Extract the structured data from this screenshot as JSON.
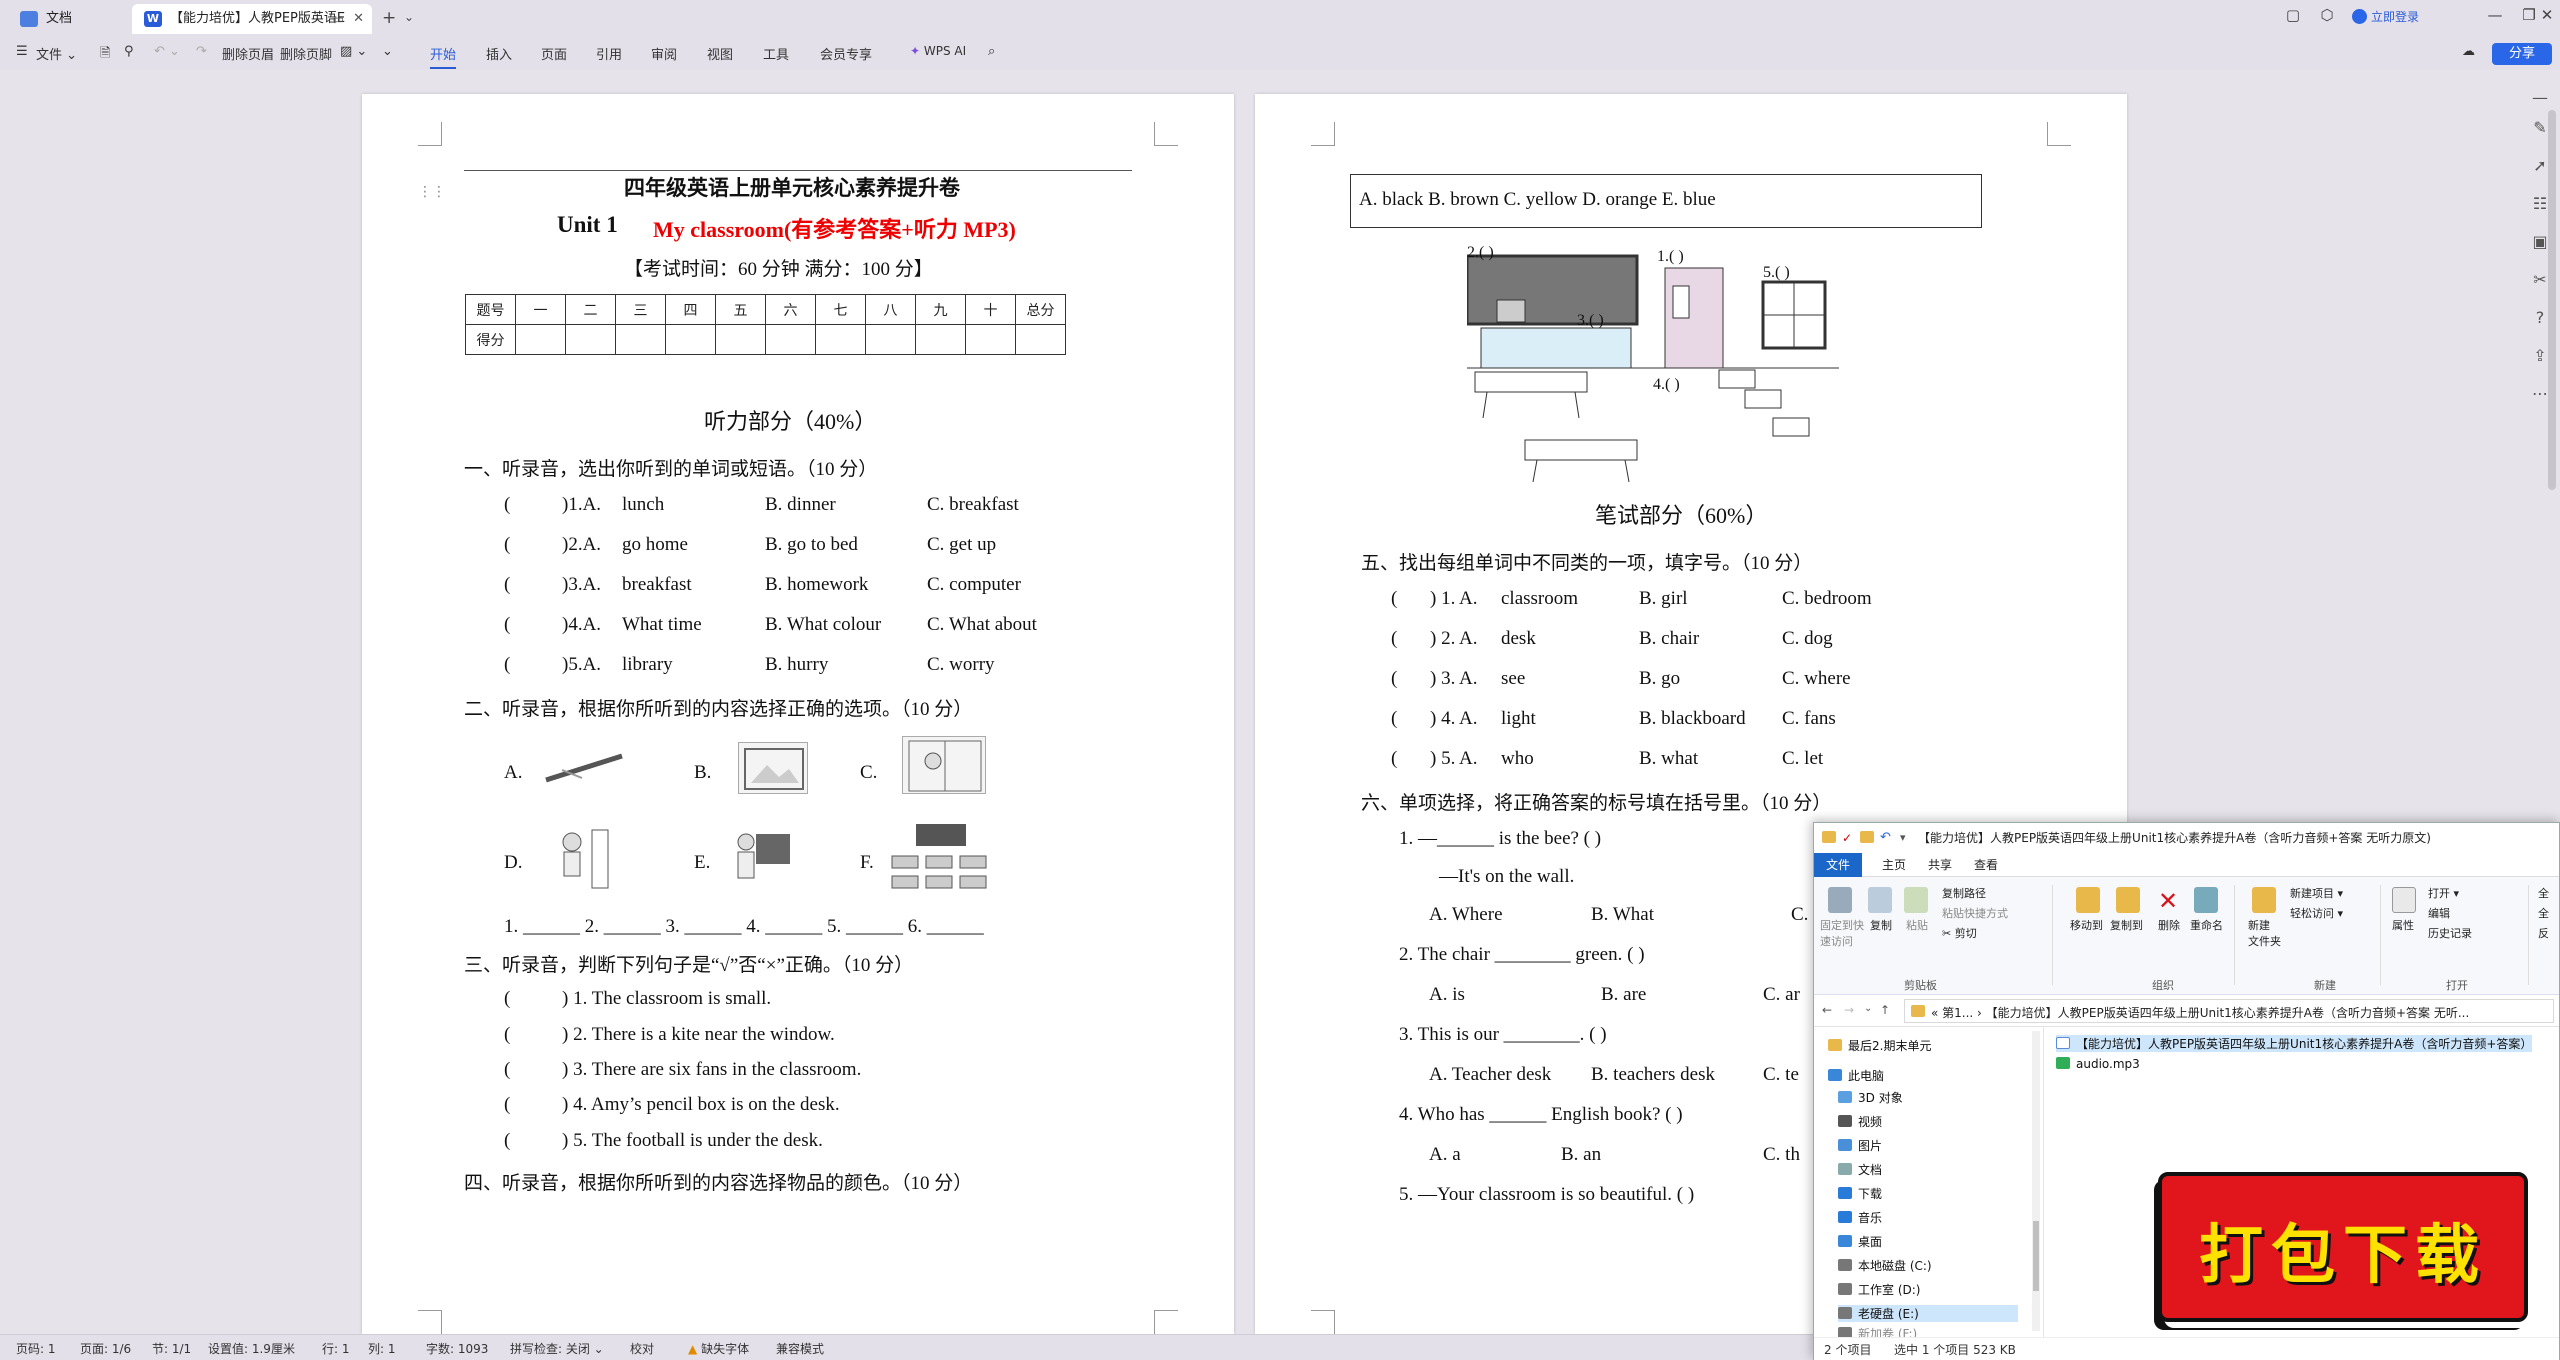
{
  "tabs": {
    "home": "文档",
    "doc": "【能力培优】人教PEP版英语E"
  },
  "titlebar": {
    "login": "立即登录"
  },
  "toolbar": {
    "file": "文件",
    "delete_header": "删除页眉",
    "delete_footer": "删除页脚",
    "menus": [
      "开始",
      "插入",
      "页面",
      "引用",
      "审阅",
      "视图",
      "工具",
      "会员专享"
    ],
    "wps_ai": "WPS AI",
    "share": "分享"
  },
  "page1": {
    "title": "四年级英语上册单元核心素养提升卷",
    "unit": "Unit 1",
    "unit_title": "My classroom(有参考答案+听力 MP3)",
    "exam_info": "【考试时间：60 分钟 满分：100 分】",
    "score_header": [
      "题号",
      "一",
      "二",
      "三",
      "四",
      "五",
      "六",
      "七",
      "八",
      "九",
      "十",
      "总分"
    ],
    "score_row_label": "得分",
    "listening_heading": "听力部分（40%）",
    "s1_title": "一、听录音，选出你听到的单词或短语。（10 分）",
    "s1_items": [
      {
        "num": ")1.A.",
        "a": "lunch",
        "b": "B.   dinner",
        "c": "C.   breakfast"
      },
      {
        "num": ")2.A.",
        "a": "go home",
        "b": "B.   go to bed",
        "c": "C.   get up"
      },
      {
        "num": ")3.A.",
        "a": "breakfast",
        "b": "B.   homework",
        "c": "C.   computer"
      },
      {
        "num": ")4.A.",
        "a": "What time",
        "b": "B.   What colour",
        "c": "C.   What about"
      },
      {
        "num": ")5.A.",
        "a": "library",
        "b": "B.   hurry",
        "c": "C.   worry"
      }
    ],
    "s2_title": "二、听录音，根据你所听到的内容选择正确的选项。（10 分）",
    "s2_labels": [
      "A.",
      "B.",
      "C.",
      "D.",
      "E.",
      "F."
    ],
    "s2_blanks": "1. ______   2. ______   3. ______   4. ______   5. ______   6. ______",
    "s3_title": "三、听录音，判断下列句子是“√”否“×”正确。（10 分）",
    "s3_items": [
      ") 1. The classroom is small.",
      ") 2. There is a kite near the window.",
      ") 3. There are six fans in the classroom.",
      ") 4. Amy’s pencil box is on the desk.",
      ") 5. The football is under the desk."
    ],
    "s4_title": "四、听录音，根据你所听到的内容选择物品的颜色。（10 分）"
  },
  "page2": {
    "colors_box": "A.  black      B.  brown      C.  yellow      D.  orange      E.  blue",
    "pic_labels": [
      "2.(      )",
      "1.(      )",
      "5.(      )",
      "3.(      )",
      "4.(      )"
    ],
    "writing_heading": "笔试部分（60%）",
    "s5_title": "五、找出每组单词中不同类的一项，填字号。（10 分）",
    "s5_items": [
      {
        "num": ")  1.  A.",
        "a": "classroom",
        "b": "B.   girl",
        "c": "C.   bedroom"
      },
      {
        "num": ")  2.  A.",
        "a": "desk",
        "b": "B.   chair",
        "c": "C.   dog"
      },
      {
        "num": ")  3.  A.",
        "a": "see",
        "b": "B.   go",
        "c": "C.   where"
      },
      {
        "num": ")  4.  A.",
        "a": "light",
        "b": "B.   blackboard",
        "c": "C.   fans"
      },
      {
        "num": ")  5.  A.",
        "a": "who",
        "b": "B.   what",
        "c": "C.   let"
      }
    ],
    "s6_title": "六、单项选择，将正确答案的标号填在括号里。（10 分）",
    "s6_q1": "1.     —______ is the bee? (     )",
    "s6_q1b": "—It's on the wall.",
    "s6_q1_opts": [
      "A.   Where",
      "B.   What",
      "C."
    ],
    "s6_q2": "2.     The chair ________ green. (     )",
    "s6_q2_opts": [
      "A.   is",
      "B.   are",
      "C.   ar"
    ],
    "s6_q3": "3.     This is our ________. (      )",
    "s6_q3_opts": [
      "A.   Teacher desk",
      "B.   teachers desk",
      "C.   te"
    ],
    "s6_q4": "4.     Who has ______ English book? (     )",
    "s6_q4_opts": [
      "A.   a",
      "B.   an",
      "C.   th"
    ],
    "s6_q5": "5.     —Your classroom is so beautiful. (     )"
  },
  "statusbar": {
    "page": "页码: 1",
    "pages": "页面: 1/6",
    "section": "节: 1/1",
    "setting": "设置值: 1.9厘米",
    "row": "行: 1",
    "col": "列: 1",
    "words": "字数: 1093",
    "spell": "拼写检查: 关闭 ⌄",
    "proof": "校对",
    "missing_font": "缺失字体",
    "compat": "兼容模式"
  },
  "explorer": {
    "title": "【能力培优】人教PEP版英语四年级上册Unit1核心素养提升A卷（含听力音频+答案 无听力原文)",
    "tabs": [
      "文件",
      "主页",
      "共享",
      "查看"
    ],
    "ribbon": {
      "pin": "固定到快\n速访问",
      "copy": "复制",
      "paste": "粘贴",
      "copy_path": "复制路径",
      "paste_shortcut": "粘贴快捷方式",
      "cut": "剪切",
      "group_clipboard": "剪贴板",
      "move_to": "移动到",
      "copy_to": "复制到",
      "delete": "删除",
      "rename": "重命名",
      "group_organize": "组织",
      "new_folder": "新建\n文件夹",
      "new_item": "新建项目 ▾",
      "easy_access": "轻松访问 ▾",
      "group_new": "新建",
      "properties": "属性",
      "open": "打开 ▾",
      "edit": "编辑",
      "history": "历史记录",
      "group_open": "打开",
      "select_all": "全",
      "select_none": "全",
      "invert": "反"
    },
    "address": "«  第1...  ›  【能力培优】人教PEP版英语四年级上册Unit1核心素养提升A卷（含听力音频+答案 无听...",
    "nav": [
      {
        "label": "最后2.期末单元",
        "color": "#e8b84a",
        "top": true
      },
      {
        "label": "此电脑",
        "color": "#3a86d9",
        "top": true
      },
      {
        "label": "3D 对象",
        "color": "#5aa0e0"
      },
      {
        "label": "视频",
        "color": "#555"
      },
      {
        "label": "图片",
        "color": "#4a90d9"
      },
      {
        "label": "文档",
        "color": "#8aa"
      },
      {
        "label": "下载",
        "color": "#2a7ad9"
      },
      {
        "label": "音乐",
        "color": "#2a7ad9"
      },
      {
        "label": "桌面",
        "color": "#3a86d9"
      },
      {
        "label": "本地磁盘 (C:)",
        "color": "#777"
      },
      {
        "label": "工作室 (D:)",
        "color": "#777"
      },
      {
        "label": "老硬盘 (E:)",
        "color": "#777"
      },
      {
        "label": "新加卷 (F:)",
        "color": "#777"
      }
    ],
    "files": [
      {
        "label": "【能力培优】人教PEP版英语四年级上册Unit1核心素养提升A卷（含听力音频+答案）",
        "selected": true
      },
      {
        "label": "audio.mp3",
        "selected": false
      }
    ],
    "status_count": "2 个项目",
    "status_selected": "选中 1 个项目  523 KB"
  },
  "badge": {
    "text": "打包下载",
    "color": "#e0161c"
  }
}
